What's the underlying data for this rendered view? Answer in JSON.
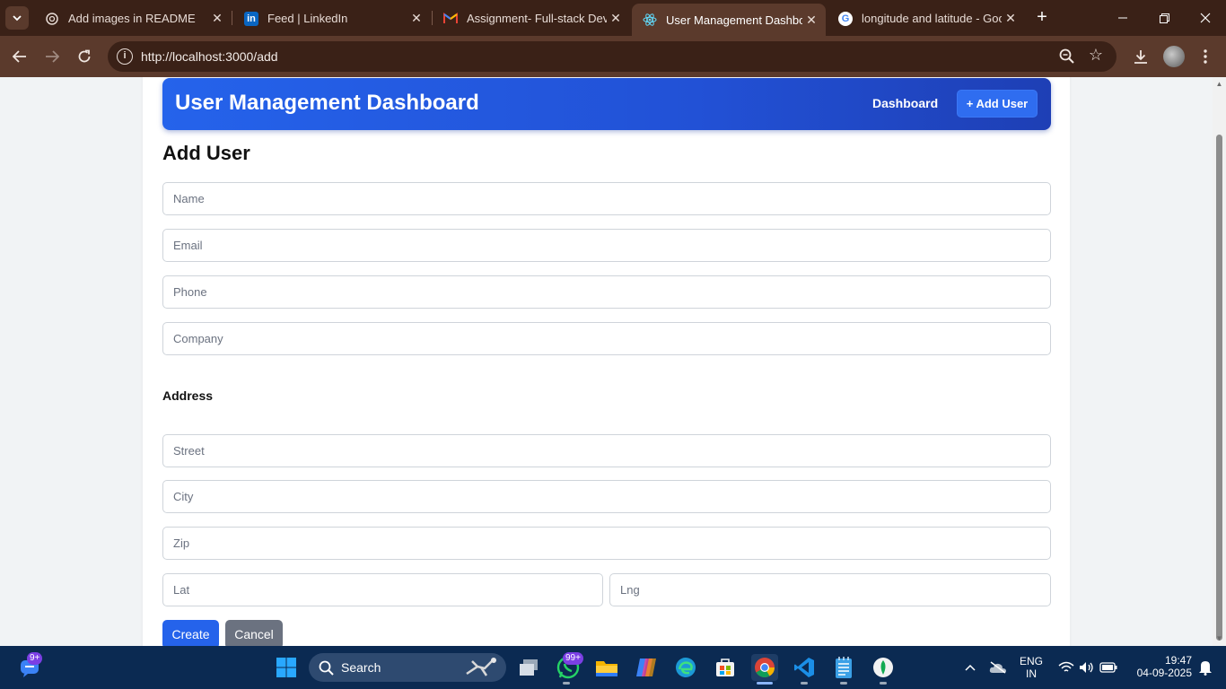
{
  "browser": {
    "tabs": [
      {
        "title": "Add images in README",
        "icon": "openai-icon"
      },
      {
        "title": "Feed | LinkedIn",
        "icon": "linkedin-icon"
      },
      {
        "title": "Assignment- Full-stack Deve",
        "icon": "gmail-icon"
      },
      {
        "title": "User Management Dashboar",
        "icon": "react-icon",
        "active": true
      },
      {
        "title": "longitude and latitude - Goo",
        "icon": "google-icon"
      }
    ],
    "url": "http://localhost:3000/add"
  },
  "header": {
    "title": "User Management Dashboard",
    "nav_dashboard": "Dashboard",
    "nav_add_user": "+ Add User"
  },
  "form": {
    "title": "Add User",
    "name_placeholder": "Name",
    "email_placeholder": "Email",
    "phone_placeholder": "Phone",
    "company_placeholder": "Company",
    "address_title": "Address",
    "street_placeholder": "Street",
    "city_placeholder": "City",
    "zip_placeholder": "Zip",
    "lat_placeholder": "Lat",
    "lng_placeholder": "Lng",
    "create_label": "Create",
    "cancel_label": "Cancel"
  },
  "taskbar": {
    "search_label": "Search",
    "whatsapp_badge": "99+",
    "chat_badge": "9+",
    "language": "ENG",
    "region": "IN",
    "time": "19:47",
    "date": "04-09-2025"
  },
  "colors": {
    "accent": "#2563eb",
    "cancel": "#6b7280",
    "browser_frame": "#5b3a2c",
    "taskbar": "#0b2a52"
  }
}
